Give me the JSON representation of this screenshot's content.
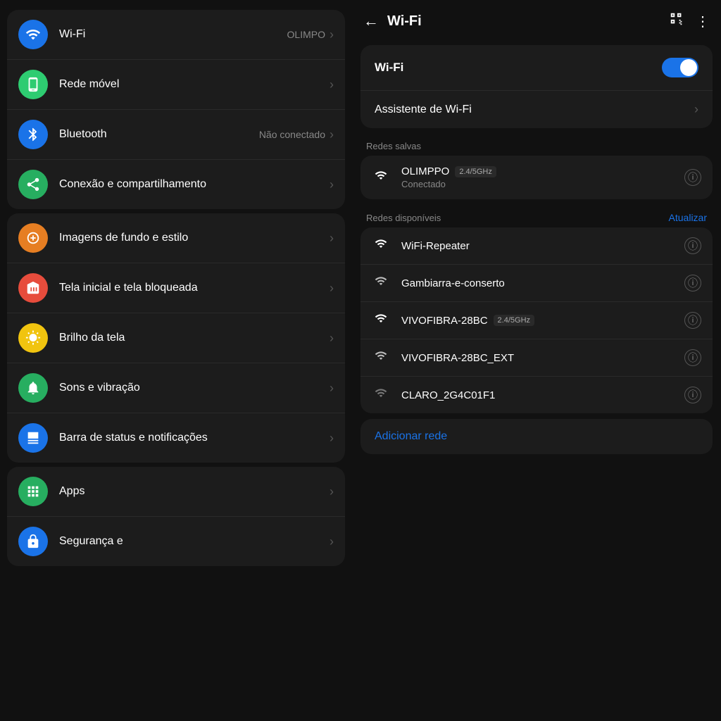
{
  "left": {
    "groups": [
      {
        "id": "connectivity",
        "items": [
          {
            "id": "wifi",
            "icon_color": "icon-blue",
            "icon_symbol": "wifi",
            "title": "Wi-Fi",
            "value": "OLIMPO",
            "subtitle": ""
          },
          {
            "id": "mobile",
            "icon_color": "icon-green",
            "icon_symbol": "mobile",
            "title": "Rede móvel",
            "value": "",
            "subtitle": ""
          },
          {
            "id": "bluetooth",
            "icon_color": "icon-blue2",
            "icon_symbol": "bluetooth",
            "title": "Bluetooth",
            "value": "Não conectado",
            "subtitle": ""
          },
          {
            "id": "connection",
            "icon_color": "icon-green2",
            "icon_symbol": "share",
            "title": "Conexão e compartilhamento",
            "value": "",
            "subtitle": ""
          }
        ]
      },
      {
        "id": "display",
        "items": [
          {
            "id": "wallpaper",
            "icon_color": "icon-orange",
            "icon_symbol": "palette",
            "title": "Imagens de fundo e estilo",
            "value": "",
            "subtitle": ""
          },
          {
            "id": "homescreen",
            "icon_color": "icon-orange2",
            "icon_symbol": "home",
            "title": "Tela inicial e tela bloqueada",
            "value": "",
            "subtitle": ""
          },
          {
            "id": "brightness",
            "icon_color": "icon-yellow",
            "icon_symbol": "sun",
            "title": "Brilho da tela",
            "value": "",
            "subtitle": ""
          },
          {
            "id": "sound",
            "icon_color": "icon-green3",
            "icon_symbol": "bell",
            "title": "Sons e vibração",
            "value": "",
            "subtitle": ""
          },
          {
            "id": "statusbar",
            "icon_color": "icon-blue3",
            "icon_symbol": "statusbar",
            "title": "Barra de status e notificações",
            "value": "",
            "subtitle": ""
          }
        ]
      },
      {
        "id": "apps",
        "items": [
          {
            "id": "apps",
            "icon_color": "icon-green4",
            "icon_symbol": "apps",
            "title": "Apps",
            "value": "",
            "subtitle": ""
          },
          {
            "id": "security",
            "icon_color": "icon-blue4",
            "icon_symbol": "lock",
            "title": "Segurança e",
            "value": "",
            "subtitle": ""
          }
        ]
      }
    ]
  },
  "right": {
    "header": {
      "back_label": "←",
      "title": "Wi-Fi",
      "qr_icon": "qr",
      "more_icon": "⋮"
    },
    "wifi_toggle": {
      "label": "Wi-Fi",
      "enabled": true
    },
    "assistant": {
      "label": "Assistente de Wi-Fi"
    },
    "saved_section": {
      "label": "Redes salvas",
      "network": {
        "name": "OLIMPPO",
        "band": "2.4/5GHz",
        "status": "Conectado"
      }
    },
    "available_section": {
      "label": "Redes disponíveis",
      "refresh_label": "Atualizar",
      "networks": [
        {
          "name": "WiFi-Repeater",
          "band": "",
          "signal": 3
        },
        {
          "name": "Gambiarra-e-conserto",
          "band": "",
          "signal": 2
        },
        {
          "name": "VIVOFIBRA-28BC",
          "band": "2.4/5GHz",
          "signal": 3
        },
        {
          "name": "VIVOFIBRA-28BC_EXT",
          "band": "",
          "signal": 2
        },
        {
          "name": "CLARO_2G4C01F1",
          "band": "",
          "signal": 1
        }
      ]
    },
    "add_network": {
      "label": "Adicionar rede"
    }
  }
}
